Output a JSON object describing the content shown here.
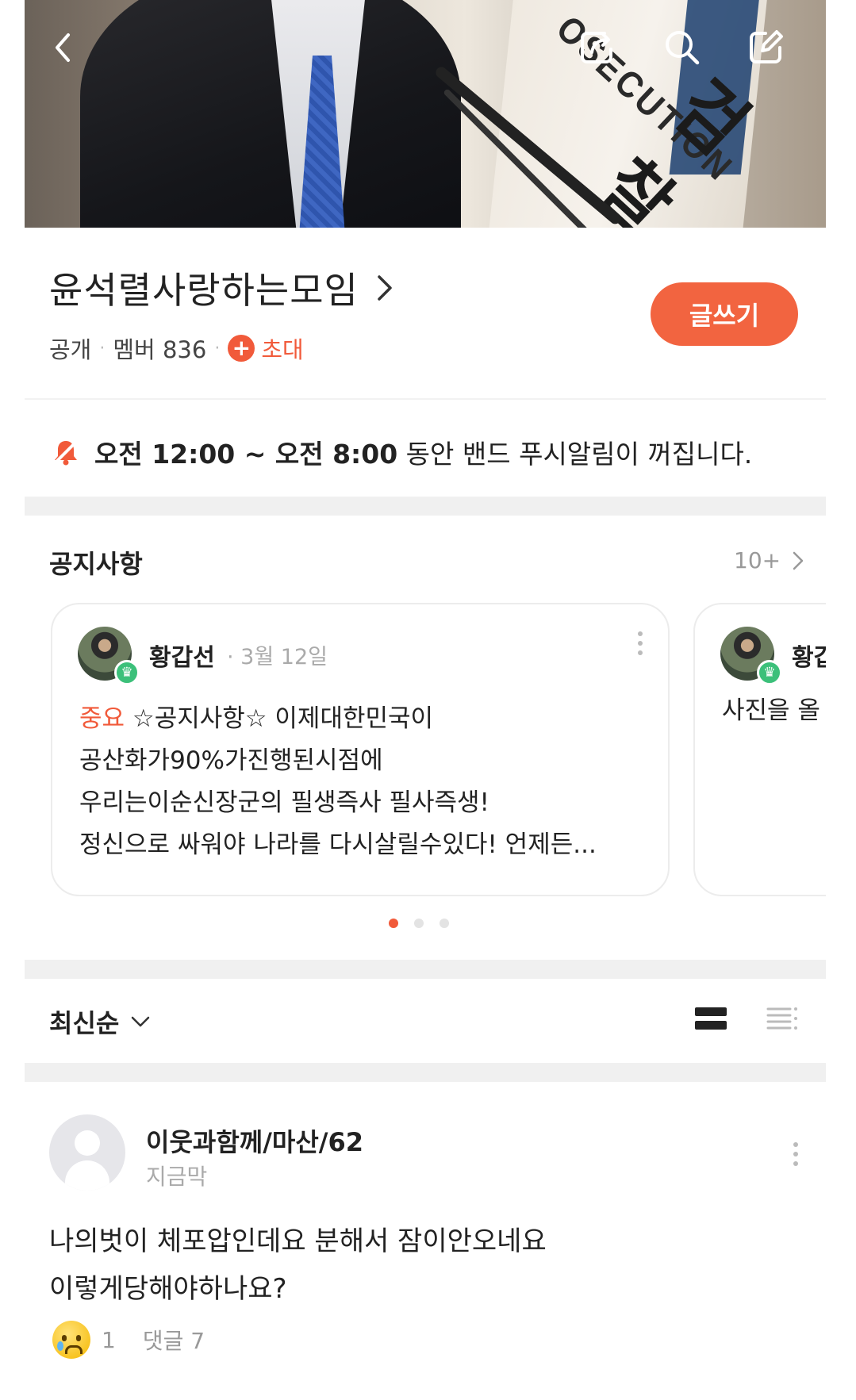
{
  "header": {
    "band_name": "윤석렬사랑하는모임",
    "visibility": "공개",
    "member_label": "멤버 836",
    "invite_label": "초대",
    "write_button": "글쓰기"
  },
  "push_notice": {
    "time_range": "오전 12:00 ~ 오전 8:00",
    "message": " 동안 밴드 푸시알림이 꺼집니다."
  },
  "notices": {
    "section_title": "공지사항",
    "more_label": "10+",
    "cards": [
      {
        "author": "황갑선",
        "date": "· 3월 12일",
        "tag": "중요",
        "lines": [
          " ☆공지사항☆ 이제대한민국이",
          "공산화가90%가진행된시점에",
          "우리는이순신장군의 필생즉사 필사즉생!",
          "정신으로 싸워야 나라를 다시살릴수있다! 언제든..."
        ]
      },
      {
        "author": "황갑",
        "body": "사진을 올"
      }
    ]
  },
  "feed": {
    "sort_label": "최신순",
    "post": {
      "author": "이웃과함께/마산/62",
      "time": "지금막",
      "lines": [
        "나의벗이 체포압인데요 분해서 잠이안오네요",
        "이렇게당해야하나요?"
      ],
      "reaction_count": "1",
      "comments": "댓글 7"
    }
  },
  "colors": {
    "accent": "#f15a3a",
    "write_button": "#f26440",
    "crown_badge": "#3cc07a"
  }
}
